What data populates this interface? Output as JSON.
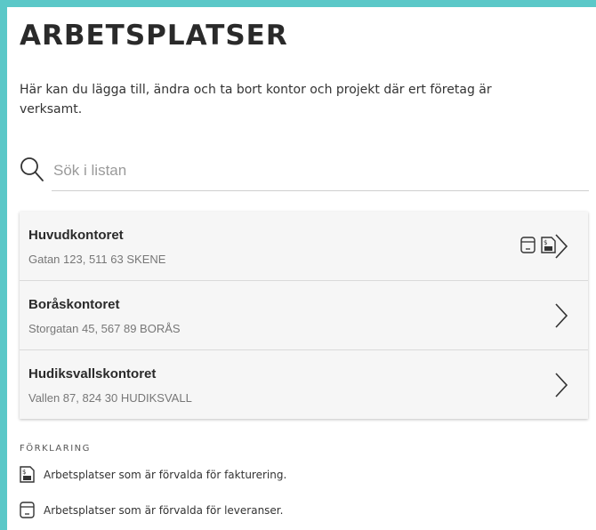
{
  "colors": {
    "accent": "#5bc8c8"
  },
  "page": {
    "title": "ARBETSPLATSER",
    "intro": "Här kan du lägga till, ändra och ta bort kontor och projekt där ert företag är verksamt."
  },
  "search": {
    "placeholder": "Sök i listan",
    "icon": "search-icon"
  },
  "workplaces": [
    {
      "name": "Huvudkontoret",
      "address": "Gatan 123, 511 63 SKENE",
      "icons": [
        "delivery-default-icon",
        "invoice-default-icon"
      ]
    },
    {
      "name": "Boråskontoret",
      "address": "Storgatan 45, 567 89 BORÅS",
      "icons": []
    },
    {
      "name": "Hudiksvallskontoret",
      "address": "Vallen 87, 824 30 HUDIKSVALL",
      "icons": []
    }
  ],
  "legend": {
    "heading": "FÖRKLARING",
    "invoice": "Arbetsplatser som är förvalda för fakturering.",
    "delivery": "Arbetsplatser som är förvalda för leveranser."
  }
}
